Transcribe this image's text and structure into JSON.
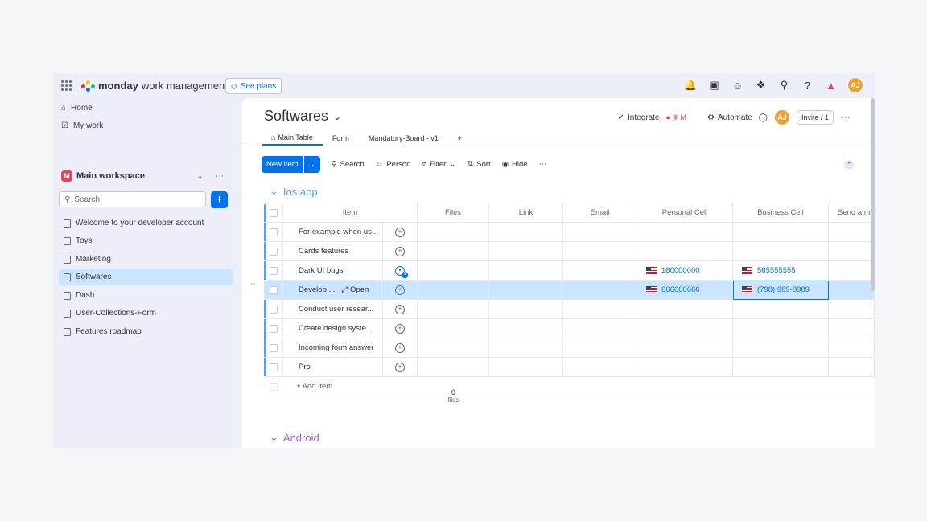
{
  "topbar": {
    "brand_bold": "monday",
    "brand_rest": "work management",
    "see_plans": "See plans",
    "avatar": "AJ",
    "icons": [
      "bell-icon",
      "inbox-icon",
      "invite-members-icon",
      "apps-icon",
      "search-icon",
      "help-icon",
      "product-switcher-icon"
    ]
  },
  "sidebar": {
    "home": "Home",
    "my_work": "My work",
    "workspace_name": "Main workspace",
    "workspace_badge": "M",
    "search_placeholder": "Search",
    "boards": [
      {
        "label": "Welcome to your developer account",
        "icon": "doc-icon"
      },
      {
        "label": "Toys",
        "icon": "board-icon"
      },
      {
        "label": "Marketing",
        "icon": "board-icon"
      },
      {
        "label": "Softwares",
        "icon": "board-icon",
        "active": true
      },
      {
        "label": "Dash",
        "icon": "dashboard-icon"
      },
      {
        "label": "User-Collections-Form",
        "icon": "board-icon"
      },
      {
        "label": "Features roadmap",
        "icon": "doc-icon"
      }
    ]
  },
  "board": {
    "title": "Softwares",
    "tabs": [
      "Main Table",
      "Form",
      "Mandatory-Board - v1",
      "+"
    ],
    "integrate": "Integrate",
    "automate": "Automate",
    "invite": "Invite / 1",
    "avatar": "AJ"
  },
  "toolbar": {
    "new_item": "New item",
    "search": "Search",
    "person": "Person",
    "filter": "Filter",
    "sort": "Sort",
    "hide": "Hide"
  },
  "groups": {
    "ios": "Ios app",
    "android": "Android"
  },
  "table": {
    "columns": [
      "Item",
      "Files",
      "Link",
      "Email",
      "Personal Cell",
      "Business Cell",
      "Send a me"
    ],
    "rows": [
      {
        "item": "For example when us...",
        "personal": "",
        "business": ""
      },
      {
        "item": "Cards features",
        "personal": "",
        "business": ""
      },
      {
        "item": "Dark UI bugs",
        "personal": "180000000",
        "business": "565555555"
      },
      {
        "item": "Develop ...",
        "personal": "666666666",
        "business": "(798) 989-8989"
      },
      {
        "item": "Conduct user resear...",
        "personal": "",
        "business": ""
      },
      {
        "item": "Create design syste...",
        "personal": "",
        "business": ""
      },
      {
        "item": "Incoming form answer",
        "personal": "",
        "business": ""
      },
      {
        "item": "Pro",
        "personal": "",
        "business": ""
      }
    ],
    "open_label": "Open",
    "add_item": "+ Add item",
    "files_count": "0",
    "files_label": "files"
  },
  "colors": {
    "accent": "#0073ea",
    "group_ios": "#579bfc",
    "group_android": "#a25ddc",
    "selected_row": "#cce5ff"
  }
}
